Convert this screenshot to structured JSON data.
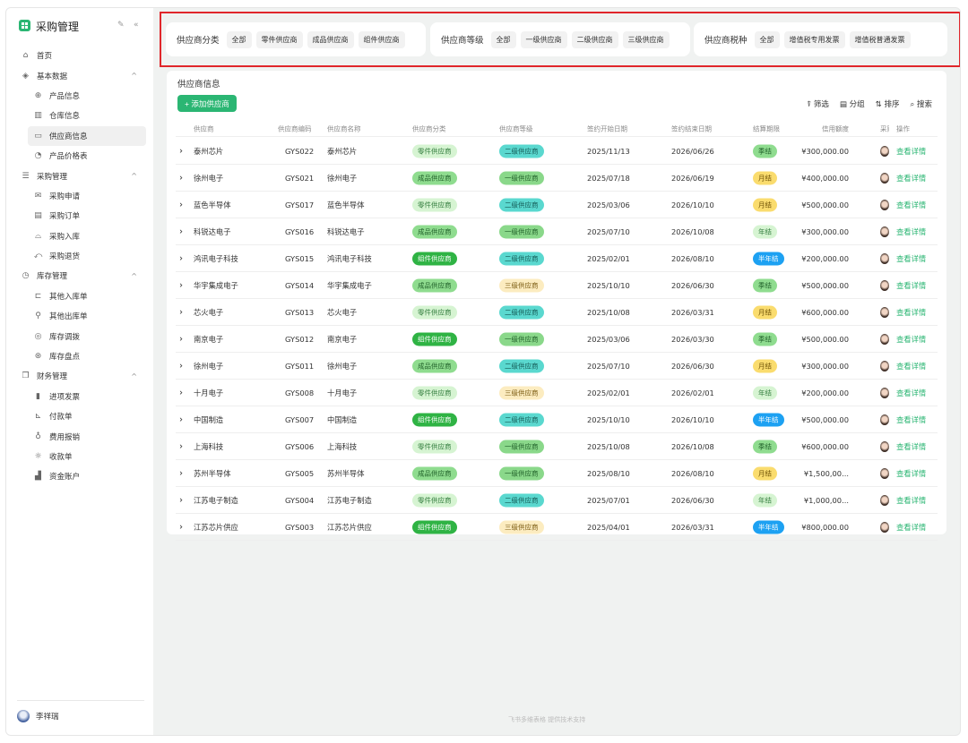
{
  "app": {
    "title": "采购管理",
    "user": "李祥瑞",
    "footer": "飞书多维表格 提供技术支持"
  },
  "sidebar": [
    {
      "label": "首页",
      "icon": "home-icon",
      "level": 0
    },
    {
      "label": "基本数据",
      "icon": "layers-icon",
      "level": 0,
      "group": true
    },
    {
      "label": "产品信息",
      "icon": "globe-icon",
      "level": 1
    },
    {
      "label": "仓库信息",
      "icon": "warehouse-icon",
      "level": 1
    },
    {
      "label": "供应商信息",
      "icon": "monitor-icon",
      "level": 1,
      "active": true
    },
    {
      "label": "产品价格表",
      "icon": "price-icon",
      "level": 1
    },
    {
      "label": "采购管理",
      "icon": "list-icon",
      "level": 0,
      "group": true
    },
    {
      "label": "采购申请",
      "icon": "mail-icon",
      "level": 1
    },
    {
      "label": "采购订单",
      "icon": "calendar-icon",
      "level": 1
    },
    {
      "label": "采购入库",
      "icon": "inbox-icon",
      "level": 1
    },
    {
      "label": "采购退货",
      "icon": "return-icon",
      "level": 1
    },
    {
      "label": "库存管理",
      "icon": "clock-icon",
      "level": 0,
      "group": true
    },
    {
      "label": "其他入库单",
      "icon": "import-icon",
      "level": 1
    },
    {
      "label": "其他出库单",
      "icon": "export-icon",
      "level": 1
    },
    {
      "label": "库存调拨",
      "icon": "transfer-icon",
      "level": 1
    },
    {
      "label": "库存盘点",
      "icon": "count-icon",
      "level": 1
    },
    {
      "label": "财务管理",
      "icon": "copy-icon",
      "level": 0,
      "group": true
    },
    {
      "label": "进项发票",
      "icon": "barcode-icon",
      "level": 1
    },
    {
      "label": "付款单",
      "icon": "chart-icon",
      "level": 1
    },
    {
      "label": "费用报销",
      "icon": "trophy-icon",
      "level": 1
    },
    {
      "label": "收款单",
      "icon": "bulb-icon",
      "level": 1
    },
    {
      "label": "资金账户",
      "icon": "bar-chart-icon",
      "level": 1
    }
  ],
  "filters": [
    {
      "label": "供应商分类",
      "options": [
        "全部",
        "零件供应商",
        "成品供应商",
        "组件供应商"
      ]
    },
    {
      "label": "供应商等级",
      "options": [
        "全部",
        "一级供应商",
        "二级供应商",
        "三级供应商"
      ]
    },
    {
      "label": "供应商税种",
      "options": [
        "全部",
        "增值税专用发票",
        "增值税普通发票"
      ]
    }
  ],
  "table": {
    "title": "供应商信息",
    "add_label": "+ 添加供应商",
    "tools": [
      "筛选",
      "分组",
      "排序",
      "搜索"
    ],
    "columns": [
      "供应商",
      "供应商编码",
      "供应商名称",
      "供应商分类",
      "供应商等级",
      "签约开始日期",
      "签约结束日期",
      "结算期限",
      "信用额度",
      "采购",
      "操作"
    ],
    "action_label": "查看详情",
    "rows": [
      [
        "泰州芯片",
        "GYS022",
        "泰州芯片",
        "零件供应商",
        "二级供应商",
        "2025/11/13",
        "2026/06/26",
        "季结",
        "¥300,000.00"
      ],
      [
        "徐州电子",
        "GYS021",
        "徐州电子",
        "成品供应商",
        "一级供应商",
        "2025/07/18",
        "2026/06/19",
        "月结",
        "¥400,000.00"
      ],
      [
        "蓝色半导体",
        "GYS017",
        "蓝色半导体",
        "零件供应商",
        "二级供应商",
        "2025/03/06",
        "2026/10/10",
        "月结",
        "¥500,000.00"
      ],
      [
        "科锐达电子",
        "GYS016",
        "科锐达电子",
        "成品供应商",
        "一级供应商",
        "2025/07/10",
        "2026/10/08",
        "年结",
        "¥300,000.00"
      ],
      [
        "鸿讯电子科技",
        "GYS015",
        "鸿讯电子科技",
        "组件供应商",
        "二级供应商",
        "2025/02/01",
        "2026/08/10",
        "半年结",
        "¥200,000.00"
      ],
      [
        "华宇集成电子",
        "GYS014",
        "华宇集成电子",
        "成品供应商",
        "三级供应商",
        "2025/10/10",
        "2026/06/30",
        "季结",
        "¥500,000.00"
      ],
      [
        "芯火电子",
        "GYS013",
        "芯火电子",
        "零件供应商",
        "二级供应商",
        "2025/10/08",
        "2026/03/31",
        "月结",
        "¥600,000.00"
      ],
      [
        "南京电子",
        "GYS012",
        "南京电子",
        "组件供应商",
        "一级供应商",
        "2025/03/06",
        "2026/03/30",
        "季结",
        "¥500,000.00"
      ],
      [
        "徐州电子",
        "GYS011",
        "徐州电子",
        "成品供应商",
        "二级供应商",
        "2025/07/10",
        "2026/06/30",
        "月结",
        "¥300,000.00"
      ],
      [
        "十月电子",
        "GYS008",
        "十月电子",
        "零件供应商",
        "三级供应商",
        "2025/02/01",
        "2026/02/01",
        "年结",
        "¥200,000.00"
      ],
      [
        "中国制造",
        "GYS007",
        "中国制造",
        "组件供应商",
        "二级供应商",
        "2025/10/10",
        "2026/10/10",
        "半年结",
        "¥500,000.00"
      ],
      [
        "上海科技",
        "GYS006",
        "上海科技",
        "零件供应商",
        "一级供应商",
        "2025/10/08",
        "2026/10/08",
        "季结",
        "¥600,000.00"
      ],
      [
        "苏州半导体",
        "GYS005",
        "苏州半导体",
        "成品供应商",
        "一级供应商",
        "2025/08/10",
        "2026/08/10",
        "月结",
        "¥1,500,00..."
      ],
      [
        "江苏电子制造",
        "GYS004",
        "江苏电子制造",
        "零件供应商",
        "二级供应商",
        "2025/07/01",
        "2026/06/30",
        "年结",
        "¥1,000,00..."
      ],
      [
        "江苏芯片供应",
        "GYS003",
        "江苏芯片供应",
        "组件供应商",
        "三级供应商",
        "2025/04/01",
        "2026/03/31",
        "半年结",
        "¥800,000.00"
      ]
    ]
  },
  "tag_colors": {
    "零件供应商": [
      "#d6f4d2",
      "#2f7a3a"
    ],
    "成品供应商": [
      "#8fdc8f",
      "#1f5f28"
    ],
    "组件供应商": [
      "#2fb344",
      "#ffffff"
    ],
    "一级供应商": [
      "#8ad88a",
      "#1f5f28"
    ],
    "二级供应商": [
      "#5ad8cf",
      "#145a55"
    ],
    "三级供应商": [
      "#fcecc0",
      "#7a5a10"
    ],
    "季结": [
      "#8fdc8f",
      "#1f5f28"
    ],
    "月结": [
      "#fadc6e",
      "#6a4d00"
    ],
    "年结": [
      "#d6f4d2",
      "#2f7a3a"
    ],
    "半年结": [
      "#1da1f2",
      "#ffffff"
    ]
  },
  "accent": "#2bb673"
}
